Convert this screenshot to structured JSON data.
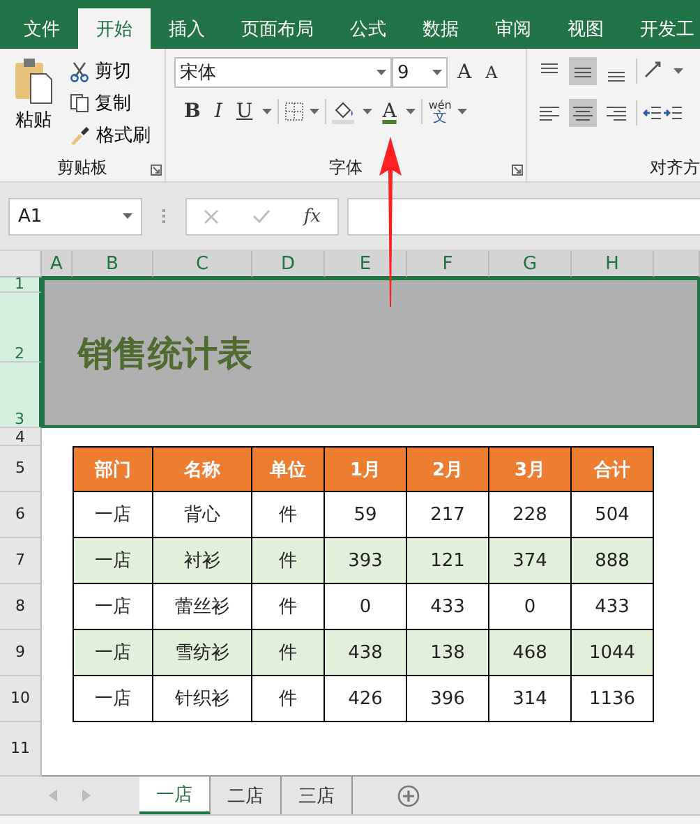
{
  "ribbon_tabs": [
    {
      "label": "文件",
      "selected": false
    },
    {
      "label": "开始",
      "selected": true
    },
    {
      "label": "插入",
      "selected": false
    },
    {
      "label": "页面布局",
      "selected": false
    },
    {
      "label": "公式",
      "selected": false
    },
    {
      "label": "数据",
      "selected": false
    },
    {
      "label": "审阅",
      "selected": false
    },
    {
      "label": "视图",
      "selected": false
    },
    {
      "label": "开发工",
      "selected": false
    }
  ],
  "clipboard": {
    "paste": "粘贴",
    "cut": "剪切",
    "copy": "复制",
    "format_painter": "格式刷",
    "group": "剪贴板"
  },
  "font": {
    "name": "宋体",
    "size": "9",
    "grow": "A",
    "shrink": "A",
    "bold": "B",
    "italic": "I",
    "underline": "U",
    "font_color": "A",
    "phonetic_top": "wén",
    "phonetic_bottom": "文",
    "group": "字体"
  },
  "alignment": {
    "group": "对齐方"
  },
  "formula_bar": {
    "name_box": "A1",
    "function_label": "fx"
  },
  "columns": [
    "A",
    "B",
    "C",
    "D",
    "E",
    "F",
    "G",
    "H"
  ],
  "rows": [
    "1",
    "2",
    "3",
    "4",
    "5",
    "6",
    "7",
    "8",
    "9",
    "10",
    "11"
  ],
  "title": "销售统计表",
  "table": {
    "headers": [
      "部门",
      "名称",
      "单位",
      "1月",
      "2月",
      "3月",
      "合计"
    ],
    "rows": [
      [
        "一店",
        "背心",
        "件",
        "59",
        "217",
        "228",
        "504"
      ],
      [
        "一店",
        "衬衫",
        "件",
        "393",
        "121",
        "374",
        "888"
      ],
      [
        "一店",
        "蕾丝衫",
        "件",
        "0",
        "433",
        "0",
        "433"
      ],
      [
        "一店",
        "雪纺衫",
        "件",
        "438",
        "138",
        "468",
        "1044"
      ],
      [
        "一店",
        "针织衫",
        "件",
        "426",
        "396",
        "314",
        "1136"
      ]
    ]
  },
  "sheet_tabs": [
    {
      "label": "一店",
      "selected": true
    },
    {
      "label": "二店",
      "selected": false
    },
    {
      "label": "三店",
      "selected": false
    }
  ]
}
